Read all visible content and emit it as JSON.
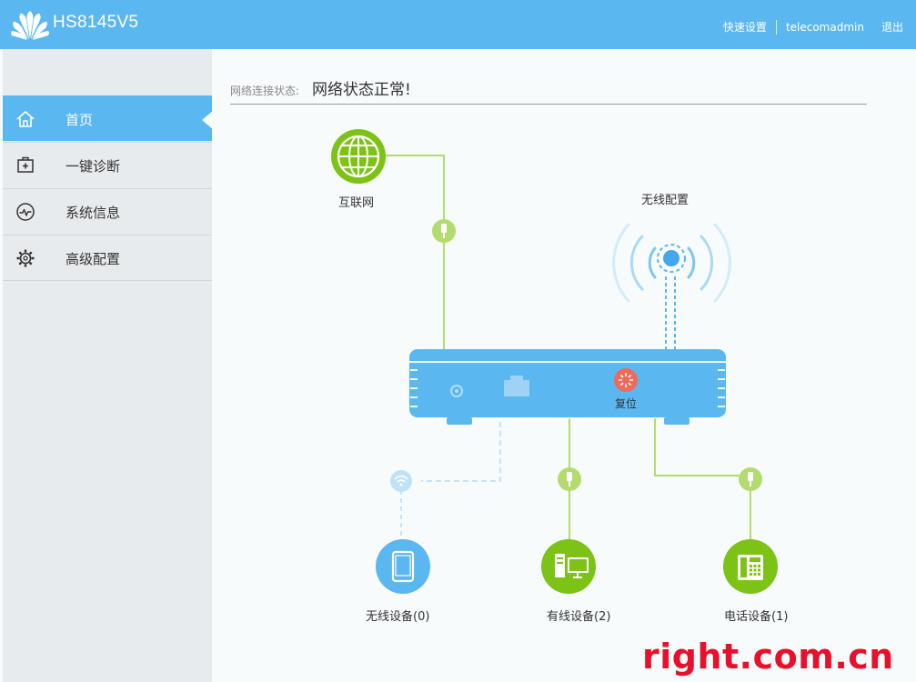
{
  "header": {
    "model": "HS8145V5",
    "links": [
      "快速设置",
      "telecomadmin",
      "退出"
    ]
  },
  "sidebar": {
    "items": [
      {
        "label": "首页",
        "icon": "home-icon",
        "active": true
      },
      {
        "label": "一键诊断",
        "icon": "first-aid-icon",
        "active": false
      },
      {
        "label": "系统信息",
        "icon": "pulse-icon",
        "active": false
      },
      {
        "label": "高级配置",
        "icon": "gear-icon",
        "active": false
      }
    ]
  },
  "status": {
    "label": "网络连接状态:",
    "value": "网络状态正常!"
  },
  "topology": {
    "internet_label": "互联网",
    "wifi_config_label": "无线配置",
    "reset_label": "复位",
    "wireless_devices_label": "无线设备(0)",
    "wired_devices_label": "有线设备(2)",
    "phone_devices_label": "电话设备(1)"
  },
  "watermark": "right.com.cn",
  "colors": {
    "header_blue": "#5ab7f0",
    "router_blue": "#5ab7f0",
    "green": "#7cc316",
    "light_green": "#b3dc6e",
    "reset_red": "#ee6b5b",
    "watermark_red": "#e8102a"
  }
}
